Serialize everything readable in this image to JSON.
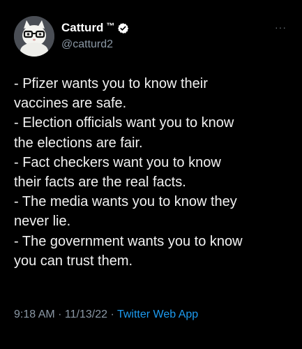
{
  "author": {
    "display_name": "Catturd",
    "trademark": "™",
    "handle": "@catturd2",
    "verified": true,
    "avatar_icon": "cat-with-glasses-avatar"
  },
  "menu_icon": "more-dots-icon",
  "colors": {
    "background": "#000000",
    "text": "#e7e9ea",
    "secondary": "#8b98a5",
    "link": "#1d9bf0",
    "verified_badge": "#ffffff"
  },
  "body_lines": [
    "- Pfizer wants you to know their",
    "vaccines are safe.",
    "- Election officials want you to know",
    "the elections are fair.",
    "- Fact checkers want you to know",
    "their facts are the real facts.",
    "- The media wants you to know they",
    "never lie.",
    "- The government wants you to know",
    "you can trust them."
  ],
  "meta": {
    "time": "9:18 AM",
    "separator": " · ",
    "date": "11/13/22",
    "app": "Twitter Web App"
  }
}
